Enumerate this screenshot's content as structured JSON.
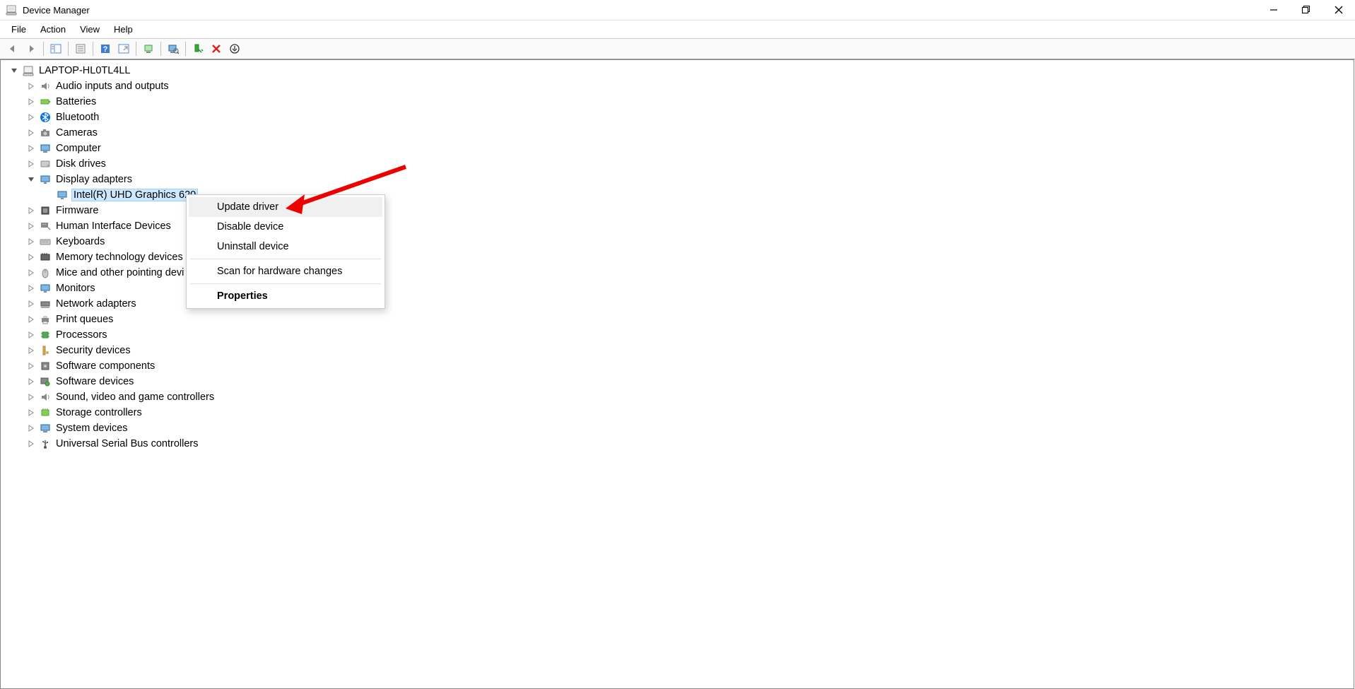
{
  "window": {
    "title": "Device Manager"
  },
  "menubar": [
    "File",
    "Action",
    "View",
    "Help"
  ],
  "tree": {
    "root": "LAPTOP-HL0TL4LL",
    "categories": [
      "Audio inputs and outputs",
      "Batteries",
      "Bluetooth",
      "Cameras",
      "Computer",
      "Disk drives",
      "Display adapters",
      "Firmware",
      "Human Interface Devices",
      "Keyboards",
      "Memory technology devices",
      "Mice and other pointing devi",
      "Monitors",
      "Network adapters",
      "Print queues",
      "Processors",
      "Security devices",
      "Software components",
      "Software devices",
      "Sound, video and game controllers",
      "Storage controllers",
      "System devices",
      "Universal Serial Bus controllers"
    ],
    "selected_device": "Intel(R) UHD Graphics 620"
  },
  "context_menu": {
    "update_driver": "Update driver",
    "disable_device": "Disable device",
    "uninstall_device": "Uninstall device",
    "scan_hardware": "Scan for hardware changes",
    "properties": "Properties"
  }
}
